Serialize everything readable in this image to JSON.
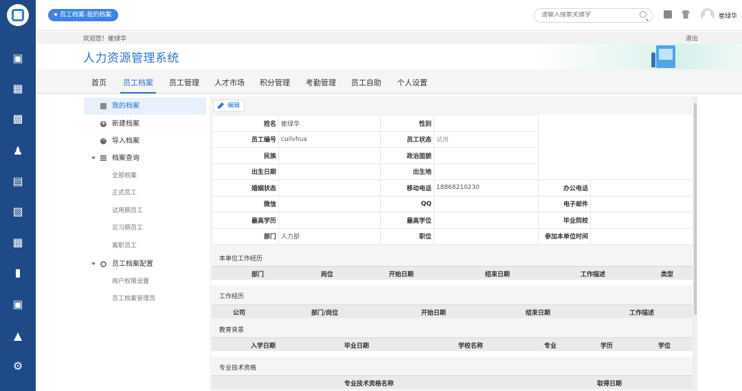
{
  "header": {
    "breadcrumb": "员工档案-我的档案",
    "search_placeholder": "请输入搜索关键字",
    "username": "崔绿华"
  },
  "welcome": {
    "text": "欢迎您！崔绿华",
    "logout": "退出"
  },
  "system_title": "人力资源管理系统",
  "nav": {
    "items": [
      {
        "label": "首页"
      },
      {
        "label": "员工档案",
        "active": true
      },
      {
        "label": "员工管理"
      },
      {
        "label": "人才市场"
      },
      {
        "label": "积分管理"
      },
      {
        "label": "考勤管理"
      },
      {
        "label": "员工自助"
      },
      {
        "label": "个人设置"
      }
    ]
  },
  "sidebar": {
    "items": [
      {
        "label": "我的档案",
        "icon": "document-icon",
        "selected": true
      },
      {
        "label": "新建档案",
        "icon": "plus-circle-icon"
      },
      {
        "label": "导入档案",
        "icon": "upload-circle-icon"
      },
      {
        "label": "档案查询",
        "icon": "stack-icon",
        "expandable": true
      },
      {
        "label": "全部档案",
        "sub": true
      },
      {
        "label": "正式员工",
        "sub": true
      },
      {
        "label": "试用期员工",
        "sub": true
      },
      {
        "label": "见习期员工",
        "sub": true
      },
      {
        "label": "离职员工",
        "sub": true
      },
      {
        "label": "员工档案配置",
        "icon": "gear-icon",
        "expandable": true
      },
      {
        "label": "用户权限设置",
        "sub": true
      },
      {
        "label": "员工档案管理员",
        "sub": true
      }
    ]
  },
  "toolbar": {
    "edit_label": "编辑"
  },
  "profile": {
    "name_label": "姓名",
    "name_value": "崔绿华",
    "gender_label": "性别",
    "gender_value": "",
    "empno_label": "员工编号",
    "empno_value": "cuilvhua",
    "status_label": "员工状态",
    "status_value": "试用",
    "ethnic_label": "民族",
    "ethnic_value": "",
    "political_label": "政治面貌",
    "political_value": "",
    "birthdate_label": "出生日期",
    "birthdate_value": "",
    "birthplace_label": "出生地",
    "birthplace_value": "",
    "marital_label": "婚姻状态",
    "marital_value": "",
    "mobile_label": "移动电话",
    "mobile_value": "18868210230",
    "officephone_label": "办公电话",
    "officephone_value": "",
    "wechat_label": "微信",
    "wechat_value": "",
    "qq_label": "QQ",
    "qq_value": "",
    "email_label": "电子邮件",
    "email_value": "",
    "education_label": "最高学历",
    "education_value": "",
    "degree_label": "最高学位",
    "degree_value": "",
    "school_label": "毕业院校",
    "school_value": "",
    "dept_label": "部门",
    "dept_value": "人力部",
    "position_label": "职位",
    "position_value": "",
    "joindate_label": "参加本单位时间",
    "joindate_value": ""
  },
  "sections": {
    "unit_exp": {
      "title": "本单位工作经历",
      "columns": [
        "部门",
        "岗位",
        "开始日期",
        "结束日期",
        "工作描述",
        "类型"
      ]
    },
    "work_exp": {
      "title": "工作经历",
      "columns": [
        "公司",
        "部门/岗位",
        "开始日期",
        "结束日期",
        "工作描述"
      ]
    },
    "education": {
      "title": "教育背景",
      "columns": [
        "入学日期",
        "毕业日期",
        "学校名称",
        "专业",
        "学历",
        "学位"
      ]
    },
    "qualification": {
      "title": "专业技术资格",
      "columns": [
        "专业技术资格名称",
        "取得日期"
      ]
    }
  },
  "colors": {
    "rail": "#1e4a87",
    "accent": "#2b74d8",
    "breadcrumb_bg": "#3d84e6"
  }
}
